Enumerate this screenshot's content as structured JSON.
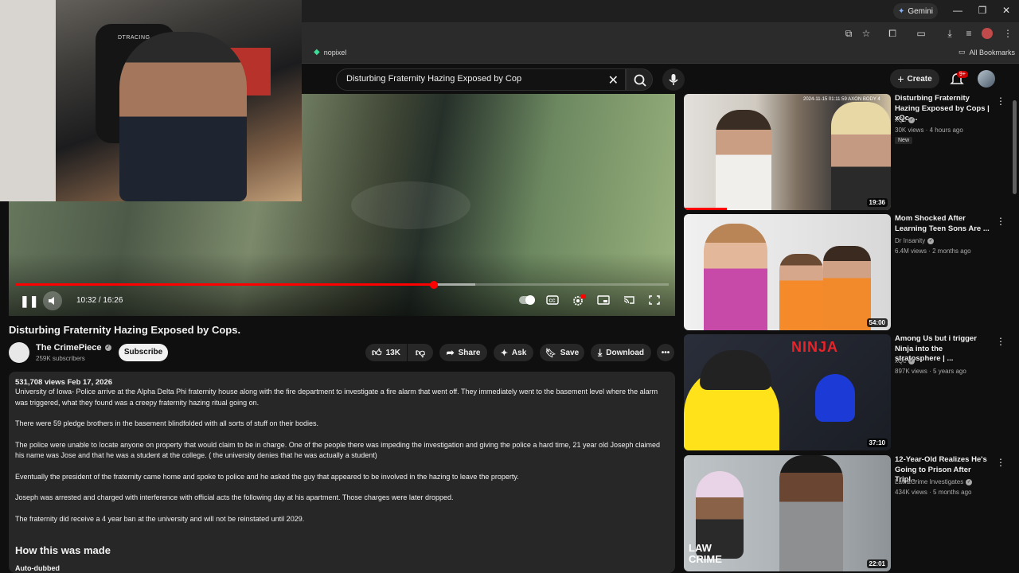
{
  "browser": {
    "gemini_label": "Gemini",
    "bookmark_nopixel": "nopixel",
    "all_bookmarks": "All Bookmarks"
  },
  "youtube": {
    "search_value": "Disturbing Fraternity Hazing Exposed by Cop",
    "create_label": "Create",
    "notification_count": "9+"
  },
  "player": {
    "current_time": "10:32",
    "total_time": "16:26",
    "time_display": "10:32 / 16:26",
    "progress_fraction": 0.641,
    "buffered_fraction": 0.704,
    "webcam_chair_label": "DTRACING"
  },
  "video": {
    "title": "Disturbing Fraternity Hazing Exposed by Cops.",
    "channel": "The CrimePiece",
    "subscribers": "259K subscribers",
    "subscribe_label": "Subscribe",
    "likes": "13K",
    "share_label": "Share",
    "ask_label": "Ask",
    "save_label": "Save",
    "download_label": "Download"
  },
  "description": {
    "meta": "531,708 views  Feb 17, 2026",
    "paragraphs": [
      "University of Iowa-    Police arrive at the Alpha Delta Phi fraternity house along with the fire department to investigate a fire alarm that went off. They immediately went to the basement level where the alarm was triggered, what they found was a creepy fraternity hazing ritual going on.",
      "There were 59 pledge brothers in the basement blindfolded with all sorts of stuff on their bodies.",
      "The police were unable to locate anyone on property that would claim to be in charge. One of the people there was impeding the investigation and giving the police a hard time, 21 year old Joseph claimed his name was Jose and that he was a student at the college. ( the university denies that he was actually a student)",
      "Eventually the president of the fraternity came home and spoke to police and he asked the guy that appeared to be involved in the hazing to leave the property.",
      "Joseph was arrested and charged with interference with official acts the following day at his apartment. Those charges were later dropped.",
      "The fraternity did receive a 4 year ban at the university and will not be reinstated until 2029."
    ],
    "how_made": "How this was made",
    "auto_dubbed": "Auto-dubbed"
  },
  "recommendations": [
    {
      "title": "Disturbing Fraternity Hazing Exposed by Cops | xQc ...",
      "channel": "xQc",
      "meta": "30K views · 4 hours ago",
      "badge": "New",
      "duration": "19:36",
      "thumb_text": "2024-11-15 01:11:59  AXON BODY 4"
    },
    {
      "title": "Mom Shocked After Learning Teen Sons Are ...",
      "channel": "Dr Insanity",
      "meta": "6.4M views · 2 months ago",
      "duration": "54:00"
    },
    {
      "title": "Among Us but i trigger Ninja into the stratosphere | ...",
      "channel": "xQc",
      "meta": "897K views · 5 years ago",
      "duration": "37:10",
      "thumb_text": "NINJA"
    },
    {
      "title": "12-Year-Old Realizes He's Going to Prison After Tripl...",
      "channel": "Law&Crime Investigates",
      "meta": "434K views · 5 months ago",
      "duration": "22:01",
      "thumb_text_line1": "LAW",
      "thumb_text_line2": "CRIME"
    }
  ]
}
